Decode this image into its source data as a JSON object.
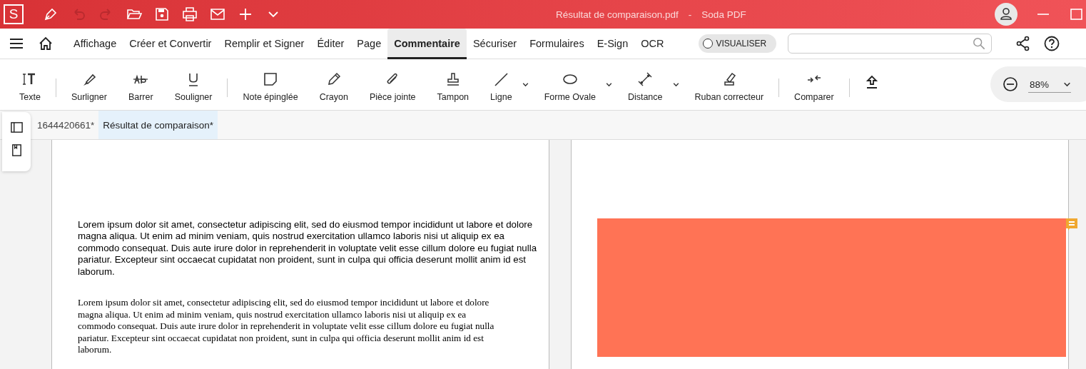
{
  "title_bar": {
    "document": "Résultat de comparaison.pdf",
    "separator": "-",
    "app": "Soda PDF",
    "logo": "S"
  },
  "menu": [
    {
      "label": "Affichage",
      "selected": false
    },
    {
      "label": "Créer et Convertir",
      "selected": false
    },
    {
      "label": "Remplir et Signer",
      "selected": false
    },
    {
      "label": "Éditer",
      "selected": false
    },
    {
      "label": "Page",
      "selected": false
    },
    {
      "label": "Commentaire",
      "selected": true
    },
    {
      "label": "Sécuriser",
      "selected": false
    },
    {
      "label": "Formulaires",
      "selected": false
    },
    {
      "label": "E-Sign",
      "selected": false
    },
    {
      "label": "OCR",
      "selected": false
    }
  ],
  "visualiser": {
    "label": "VISUALISER",
    "on": false
  },
  "toolbar": [
    {
      "kind": "tool",
      "label": "Texte",
      "dropdown": false
    },
    {
      "kind": "separator"
    },
    {
      "kind": "tool",
      "label": "Surligner",
      "dropdown": false
    },
    {
      "kind": "tool",
      "label": "Barrer",
      "dropdown": false
    },
    {
      "kind": "tool",
      "label": "Souligner",
      "dropdown": false
    },
    {
      "kind": "separator"
    },
    {
      "kind": "tool",
      "label": "Note épinglée",
      "dropdown": false
    },
    {
      "kind": "tool",
      "label": "Crayon",
      "dropdown": false
    },
    {
      "kind": "tool",
      "label": "Pièce jointe",
      "dropdown": false
    },
    {
      "kind": "tool",
      "label": "Tampon",
      "dropdown": false
    },
    {
      "kind": "tool",
      "label": "Ligne",
      "dropdown": true
    },
    {
      "kind": "tool",
      "label": "Forme Ovale",
      "dropdown": true
    },
    {
      "kind": "tool",
      "label": "Distance",
      "dropdown": true
    },
    {
      "kind": "tool",
      "label": "Ruban correcteur",
      "dropdown": false
    },
    {
      "kind": "separator"
    },
    {
      "kind": "tool",
      "label": "Comparer",
      "dropdown": false
    },
    {
      "kind": "separator"
    },
    {
      "kind": "upload"
    }
  ],
  "zoom": {
    "value": "88%"
  },
  "document_tabs": [
    {
      "label": "1644420661*",
      "selected": false
    },
    {
      "label": "Résultat de comparaison*",
      "selected": true
    }
  ],
  "left_page": {
    "paragraphs": [
      "Lorem ipsum dolor sit amet, consectetur adipiscing elit, sed do eiusmod tempor incididunt ut labore et dolore magna aliqua. Ut enim ad minim veniam, quis nostrud exercitation ullamco laboris nisi ut aliquip ex ea commodo consequat. Duis aute irure dolor in reprehenderit in voluptate velit esse cillum dolore eu fugiat nulla pariatur. Excepteur sint occaecat cupidatat non proident, sunt in culpa qui officia deserunt mollit anim id est laborum.",
      "Lorem ipsum dolor sit amet, consectetur adipiscing elit, sed do eiusmod tempor incididunt ut labore et dolore magna aliqua. Ut enim ad minim veniam, quis nostrud exercitation ullamco laboris nisi ut aliquip ex ea commodo consequat. Duis aute irure dolor in reprehenderit in voluptate velit esse cillum dolore eu fugiat nulla pariatur. Excepteur sint occaecat cupidatat non proident, sunt in culpa qui officia deserunt mollit anim id est laborum."
    ]
  },
  "right_page": {
    "highlight": {
      "color": "#ff7355",
      "comment": true
    }
  }
}
